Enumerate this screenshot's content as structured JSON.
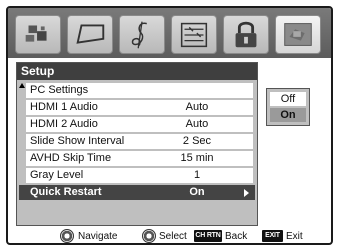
{
  "tabs": [
    {
      "name": "picture-icon"
    },
    {
      "name": "screen-icon"
    },
    {
      "name": "audio-icon"
    },
    {
      "name": "function-icon"
    },
    {
      "name": "lock-icon"
    },
    {
      "name": "setup-icon",
      "active": true
    }
  ],
  "setup": {
    "title": "Setup",
    "rows": [
      {
        "label": "PC Settings",
        "value": ""
      },
      {
        "label": "HDMI 1 Audio",
        "value": "Auto"
      },
      {
        "label": "HDMI 2 Audio",
        "value": "Auto"
      },
      {
        "label": "Slide Show Interval",
        "value": "2 Sec"
      },
      {
        "label": "AVHD Skip Time",
        "value": "15 min"
      },
      {
        "label": "Gray Level",
        "value": "1"
      },
      {
        "label": "Quick Restart",
        "value": "On",
        "selected": true
      }
    ]
  },
  "options": {
    "off": "Off",
    "on": "On",
    "selected": "On"
  },
  "footer": {
    "navigate_label": "Navigate",
    "select_label": "Select",
    "back_key": "CH RTN",
    "back_label": "Back",
    "exit_key": "EXIT",
    "exit_label": "Exit"
  }
}
